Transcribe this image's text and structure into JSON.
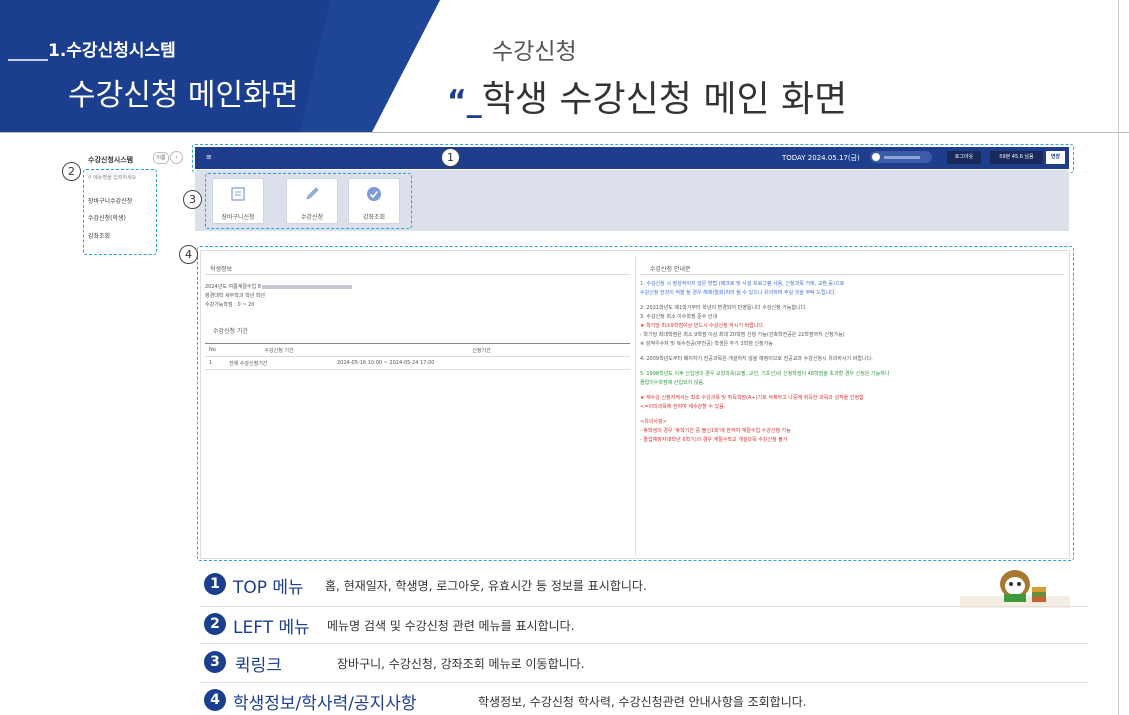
{
  "header": {
    "section_number": "1.",
    "section_name": "수강신청시스템",
    "page_name": "수강신청 메인화면",
    "subtitle": "수강신청",
    "quote_mark": "“",
    "title": "학생 수강신청 메인 화면"
  },
  "left_menu": {
    "title": "수강신청시스템",
    "toggle_label": "이름",
    "search_placeholder": "메뉴명을 입력하세요",
    "items": [
      "장바구니수강신청",
      "수강신청(학생)",
      "강좌조회"
    ]
  },
  "top_bar": {
    "home_icon": "≡",
    "today": "TODAY 2024.05.17(금)",
    "logout": "로그아웃",
    "remaining_time": "59분 45.6 남음",
    "extend": "연장"
  },
  "quick_links": [
    {
      "label": "장바구니신청",
      "icon": "basket-icon"
    },
    {
      "label": "수강신청",
      "icon": "pencil-icon"
    },
    {
      "label": "강좌조회",
      "icon": "check-icon"
    }
  ],
  "student_info": {
    "heading": "학생정보",
    "lines": [
      "2024년도 여름계절수업 8",
      "정경대학 세무학과 학년 학년",
      "수강가능학점 : 0 ~ 20"
    ]
  },
  "period": {
    "heading": "수강신청 기간",
    "columns": [
      "No",
      "수강신청 기간",
      "신청기간"
    ],
    "rows": [
      [
        "1",
        "전체 수강신청기간",
        "2024-05-16 10:00 ~ 2024-05-24 17:00"
      ]
    ]
  },
  "notice": {
    "heading": "수강신청 안내문",
    "lines": [
      {
        "text": "1. 수강신청 시 정상적이지 않은 방법 (매크로 및 사설 프로그램 사용, 신청과목 거래, 교환 등)으로",
        "color": "#3b6fd4"
      },
      {
        "text": "   수강신청 한것이 적발 될 경우 해제(철회)처리 될 수 있으니 유의하여 주실 것을 부탁 드립니다.",
        "color": "#3b6fd4"
      },
      {
        "text": "2. 2021학년도 제1학기부터 학년이 변경되어 반영됩니다 수강신청 가능합니다.",
        "color": "#555555"
      },
      {
        "text": "3. 수강신청 최소 이수학점 준수 안내",
        "color": "#555555"
      },
      {
        "text": "  ★ 학기당 최소9학점이상 반드시 수강신청 하시기 바랍니다.",
        "color": "#d83030"
      },
      {
        "text": "  - 학기당 최대학점은 최소 9학점 이상 최대 20학점 신청 가능(건축학전공은 22학점까지 신청가능)",
        "color": "#555555"
      },
      {
        "text": "    ※ 성적우수자 및 복수전공(부전공) 학생은 추가 3학점 신청가능",
        "color": "#555555"
      },
      {
        "text": "4. 2009학년도부터 폐지하기 전공과목은 개설하지 않을 예정이므로 전공교과 수강신청시 유의하시기 바랍니다.",
        "color": "#555555"
      },
      {
        "text": "5. 1998학년도 이후 신입생의 경우 교양과목(교필, 교선, 기초선)의 신청학점이 48학점을 초과할 경우 신청은 가능하나",
        "color": "#2f9a3a"
      },
      {
        "text": "   졸업이수학점에 산입되지 않음.",
        "color": "#2f9a3a"
      },
      {
        "text": "  ★ 재수강 신청자께서는 최초 수강과목 및 취득학점(A+)기호 삭제하고 나중에 취득한 과목과 성적을 인정함",
        "color": "#d83030"
      },
      {
        "text": "    <=이미과목에 한하여 재수강할 수 있음.",
        "color": "#d83030"
      },
      {
        "text": "<유의사항>",
        "color": "#d83030"
      },
      {
        "text": "- 휴학생의 경우 '휴학기간 중 불신1회'에 한하여 계절수업 수강신청 가능",
        "color": "#d83030"
      },
      {
        "text": "- 졸업예정자(8학년 6학기)의 경우 계절수학교 개설과목 수강신청 불가",
        "color": "#d83030"
      }
    ]
  },
  "callouts": [
    "1",
    "2",
    "3",
    "4"
  ],
  "legend": [
    {
      "num": "1",
      "head": "TOP 메뉴",
      "desc": "홈, 현재일자, 학생명, 로그아웃, 유효시간 등 정보를 표시합니다."
    },
    {
      "num": "2",
      "head": "LEFT 메뉴",
      "desc": "메뉴명 검색 및 수강신청 관련 메뉴를 표시합니다."
    },
    {
      "num": "3",
      "head": "퀵링크",
      "desc": "장바구니, 수강신청, 강좌조회  메뉴로 이동합니다."
    },
    {
      "num": "4",
      "head": "학생정보/학사력/공지사항",
      "desc": "학생정보, 수강신청 학사력, 수강신청관련 안내사항을 조회합니다."
    }
  ],
  "colors": {
    "navy": "#1e3d8c",
    "banner": "#1b3f8e",
    "callout": "#29a3dc"
  }
}
